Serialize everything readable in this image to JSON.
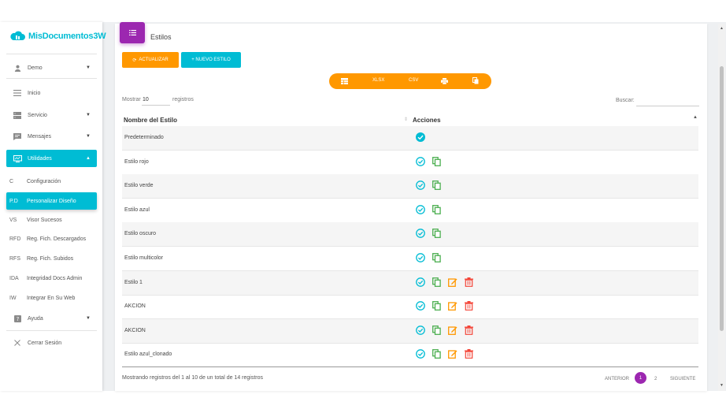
{
  "app": {
    "brand": "MisDocumentos3W"
  },
  "sidebar": {
    "user": {
      "label": "Demo"
    },
    "items": [
      {
        "label": "Inicio",
        "icon": "menu-lines-icon"
      },
      {
        "label": "Servicio",
        "icon": "server-icon"
      },
      {
        "label": "Mensajes",
        "icon": "message-icon"
      },
      {
        "label": "Utilidades",
        "icon": "monitor-icon"
      }
    ],
    "sub_items": [
      {
        "abbr": "C",
        "label": "Configuración"
      },
      {
        "abbr": "P.D",
        "label": "Personalizar Diseño"
      },
      {
        "abbr": "VS",
        "label": "Visor Sucesos"
      },
      {
        "abbr": "RFD",
        "label": "Reg. Fich. Descargados"
      },
      {
        "abbr": "RFS",
        "label": "Reg. Fich. Subidos"
      },
      {
        "abbr": "IDA",
        "label": "Integridad Docs Admin"
      },
      {
        "abbr": "IW",
        "label": "Integrar En Su Web"
      }
    ],
    "help": "Ayuda",
    "logout": "Cerrar Sesión"
  },
  "page": {
    "title": "Estilos"
  },
  "toolbar": {
    "refresh_label": "ACTUALIZAR",
    "new_label": "+ NUEVO ESTILO",
    "export": {
      "xlsx": "XLSX",
      "csv": "CSV"
    }
  },
  "table_controls": {
    "show_label": "Mostrar",
    "show_value": "10",
    "records_label": "registros",
    "search_label": "Buscar:"
  },
  "table": {
    "headers": {
      "name": "Nombre del Estilo",
      "actions": "Acciones"
    },
    "rows": [
      {
        "name": "Predeterminado",
        "actions": [
          "active"
        ]
      },
      {
        "name": "Estilo rojo",
        "actions": [
          "select",
          "copy"
        ]
      },
      {
        "name": "Estilo verde",
        "actions": [
          "select",
          "copy"
        ]
      },
      {
        "name": "Estilo azul",
        "actions": [
          "select",
          "copy"
        ]
      },
      {
        "name": "Estilo oscuro",
        "actions": [
          "select",
          "copy"
        ]
      },
      {
        "name": "Estilo multicolor",
        "actions": [
          "select",
          "copy"
        ]
      },
      {
        "name": "Estilo 1",
        "actions": [
          "select",
          "copy",
          "edit",
          "delete"
        ]
      },
      {
        "name": "AKCION",
        "actions": [
          "select",
          "copy",
          "edit",
          "delete"
        ]
      },
      {
        "name": "AKCION",
        "actions": [
          "select",
          "copy",
          "edit",
          "delete"
        ]
      },
      {
        "name": "Estilo azul_clonado",
        "actions": [
          "select",
          "copy",
          "edit",
          "delete"
        ]
      }
    ]
  },
  "footer": {
    "info": "Mostrando registros del 1 al 10 de un total de 14 registros",
    "prev": "ANTERIOR",
    "pages": [
      "1",
      "2"
    ],
    "next": "SIGUIENTE"
  },
  "colors": {
    "accent": "#00bcd4",
    "purple": "#9c27b0",
    "orange": "#ff9800",
    "green": "#4caf50",
    "red": "#f44336"
  }
}
